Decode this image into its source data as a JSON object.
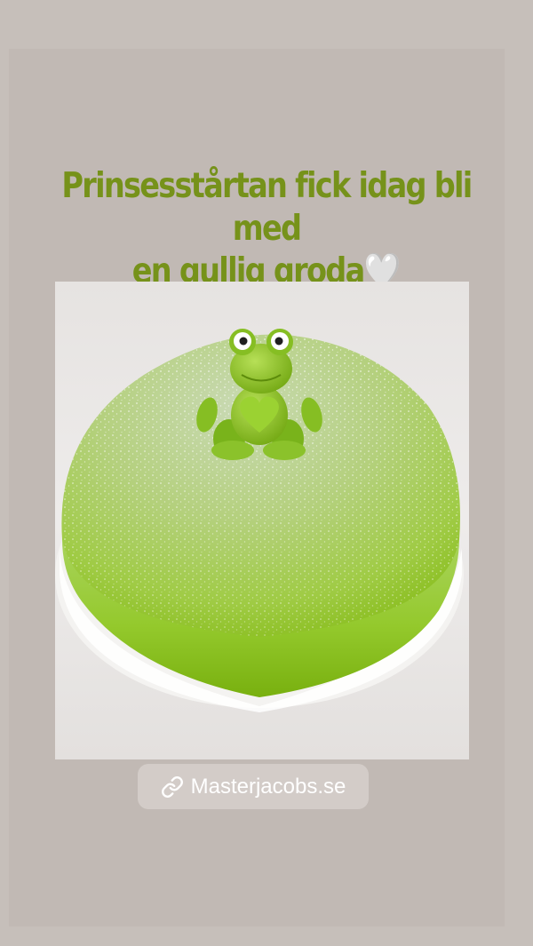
{
  "story": {
    "caption_line1": "Prinsesstårtan fick idag bli med",
    "caption_line2": "en gullig groda",
    "caption_emoji": "🤍",
    "link_sticker": {
      "icon": "link-icon",
      "label": "Masterjacobs.se"
    }
  },
  "colors": {
    "caption_text": "#76921a",
    "background": "#c6bfba",
    "cake_green": "#8dc61e",
    "sticker_text": "#ffffff"
  }
}
